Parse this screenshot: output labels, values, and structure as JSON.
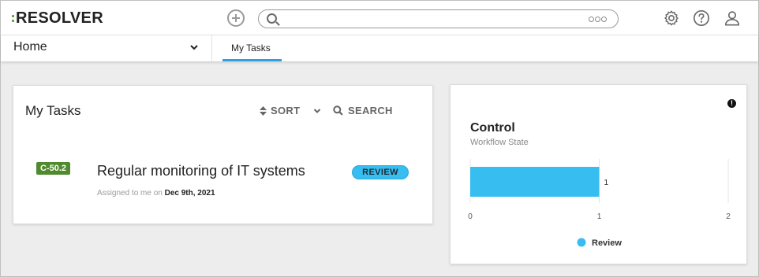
{
  "header": {
    "logo_text": "RESOLVER",
    "search": {
      "placeholder": "",
      "value": ""
    },
    "icons": [
      "add-icon",
      "search-icon",
      "more-icon",
      "gear-icon",
      "help-icon",
      "user-icon"
    ]
  },
  "nav": {
    "dropdown_label": "Home",
    "tabs": [
      {
        "label": "My Tasks",
        "active": true
      }
    ]
  },
  "tasks_panel": {
    "title": "My Tasks",
    "sort_label": "SORT",
    "search_label": "SEARCH",
    "tasks": [
      {
        "id": "C-50.2",
        "name": "Regular monitoring of IT systems",
        "assigned_prefix": "Assigned to me on",
        "assigned_date": "Dec 9th, 2021",
        "state": "REVIEW"
      }
    ]
  },
  "chart_panel": {
    "title": "Control",
    "subtitle": "Workflow State"
  },
  "chart_data": {
    "type": "bar",
    "orientation": "horizontal",
    "title": "Control",
    "subtitle": "Workflow State",
    "categories": [
      "Review"
    ],
    "series": [
      {
        "name": "Review",
        "values": [
          1
        ],
        "color": "#38bdf0"
      }
    ],
    "data_labels": [
      "1"
    ],
    "xlim": [
      0,
      2
    ],
    "x_ticks": [
      "0",
      "1",
      "2"
    ],
    "grid": true,
    "legend": "bottom",
    "legend_entries": [
      "Review"
    ]
  },
  "colors": {
    "accent": "#2f9fe0",
    "id_badge": "#4f8a2e",
    "review": "#38bdf0"
  }
}
